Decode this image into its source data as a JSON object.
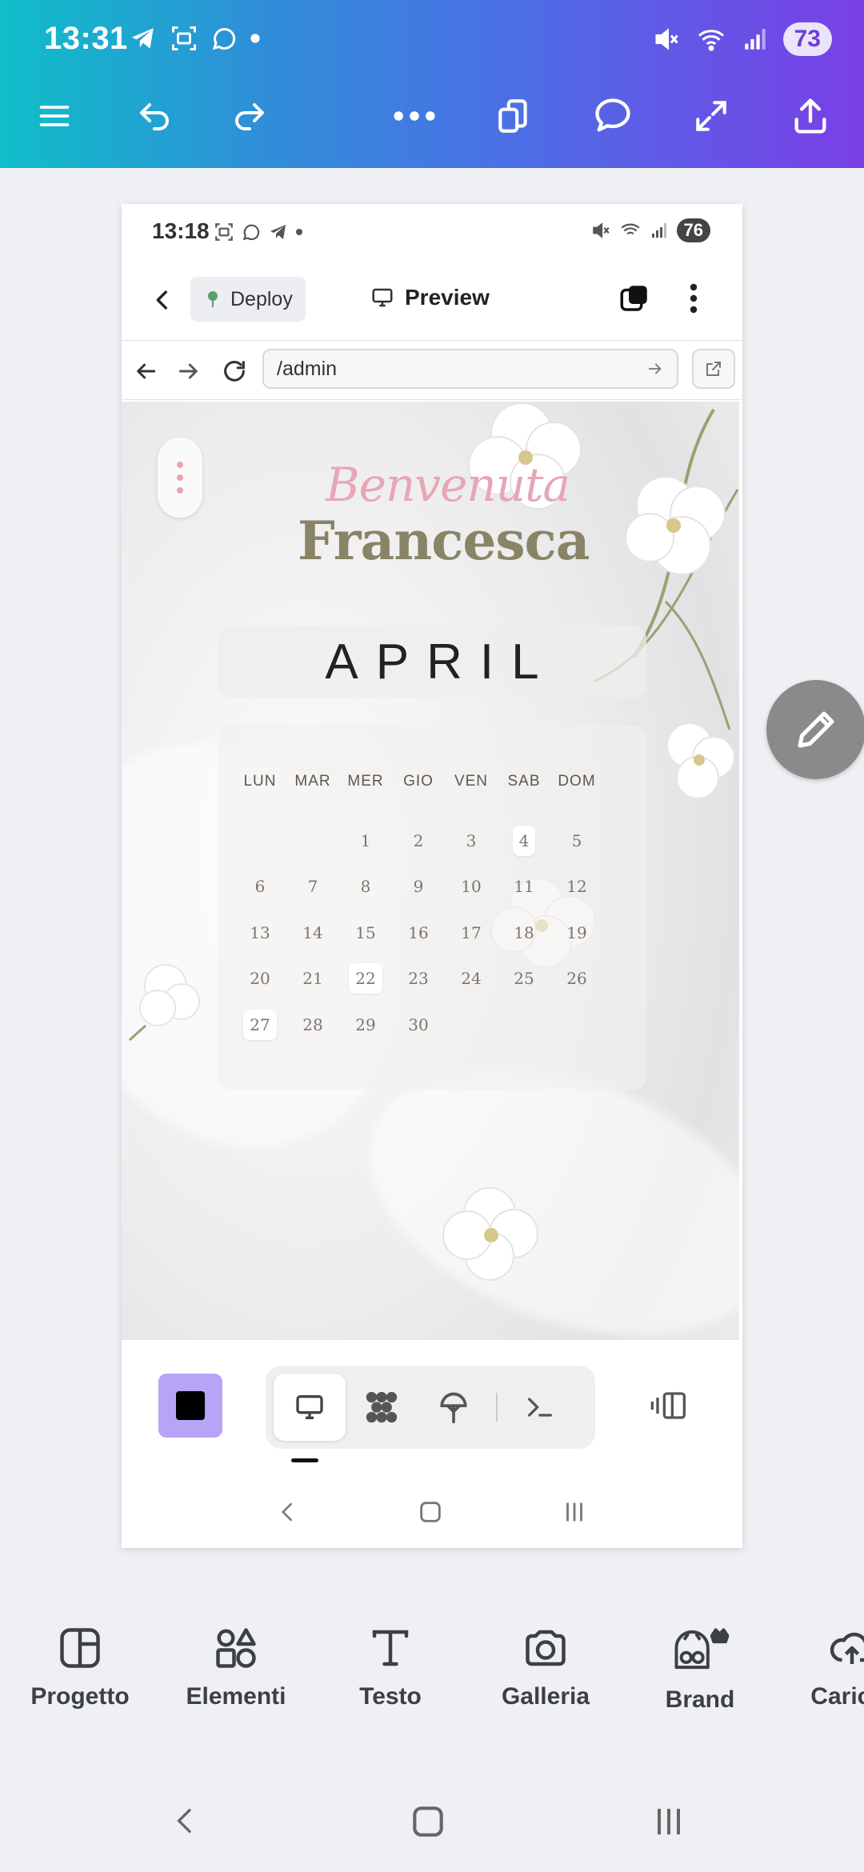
{
  "status_bar": {
    "time": "13:31",
    "battery": "73"
  },
  "toolbar": {
    "menu": "menu",
    "undo": "undo",
    "redo": "redo"
  },
  "preview": {
    "status": {
      "time": "13:18",
      "battery": "76"
    },
    "appbar": {
      "deploy_label": "Deploy",
      "preview_label": "Preview"
    },
    "url": {
      "value": "/admin"
    },
    "web": {
      "welcome_script": "Benvenuta",
      "welcome_name": "Francesca",
      "month": "APRIL",
      "weekdays": [
        "LUN",
        "MAR",
        "MER",
        "GIO",
        "VEN",
        "SAB",
        "DOM"
      ],
      "weeks": [
        [
          "",
          "",
          "1",
          "2",
          "3",
          "4",
          "5"
        ],
        [
          "6",
          "7",
          "8",
          "9",
          "10",
          "11",
          "12"
        ],
        [
          "13",
          "14",
          "15",
          "16",
          "17",
          "18",
          "19"
        ],
        [
          "20",
          "21",
          "22",
          "23",
          "24",
          "25",
          "26"
        ],
        [
          "27",
          "28",
          "29",
          "30",
          "",
          "",
          ""
        ]
      ],
      "highlighted_days": [
        "4",
        "22",
        "27"
      ]
    }
  },
  "tools": [
    {
      "label": "Progetto",
      "icon": "layout-icon"
    },
    {
      "label": "Elementi",
      "icon": "elements-icon"
    },
    {
      "label": "Testo",
      "icon": "text-icon"
    },
    {
      "label": "Galleria",
      "icon": "camera-icon"
    },
    {
      "label": "Brand",
      "icon": "brand-icon"
    },
    {
      "label": "Caricar",
      "icon": "upload-cloud-icon"
    }
  ],
  "colors": {
    "header_gradient_start": "#0fbec8",
    "header_gradient_end": "#7a3fe6",
    "stop_button": "#b8a4f6",
    "welcome_script": "#e7a6b3",
    "welcome_name": "#8a8466"
  }
}
